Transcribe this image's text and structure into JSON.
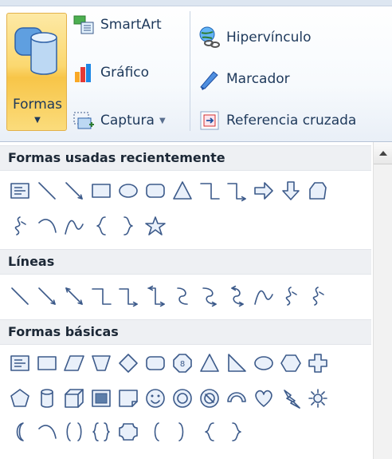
{
  "ribbon": {
    "formas": {
      "label": "Formas",
      "icon": "shapes-icon"
    },
    "illustrations": [
      {
        "label": "SmartArt",
        "icon": "smartart-icon"
      },
      {
        "label": "Gráfico",
        "icon": "chart-icon"
      },
      {
        "label": "Captura",
        "icon": "screenshot-icon",
        "has_dropdown": true
      }
    ],
    "links": [
      {
        "label": "Hipervínculo",
        "icon": "hyperlink-icon"
      },
      {
        "label": "Marcador",
        "icon": "bookmark-icon"
      },
      {
        "label": "Referencia cruzada",
        "icon": "cross-reference-icon"
      }
    ]
  },
  "gallery": {
    "sections": [
      {
        "title": "Formas usadas recientemente",
        "rows": [
          [
            "text-box",
            "line",
            "arrow-line",
            "rectangle",
            "oval",
            "rounded-rectangle",
            "triangle",
            "elbow-connector",
            "elbow-arrow-connector",
            "right-arrow",
            "down-arrow",
            "flowchart-shape"
          ],
          [
            "freeform",
            "arc",
            "curve",
            "left-brace",
            "right-brace",
            "star"
          ]
        ]
      },
      {
        "title": "Líneas",
        "rows": [
          [
            "line",
            "arrow-line",
            "double-arrow-line",
            "elbow-connector",
            "elbow-arrow-connector",
            "elbow-double-arrow-connector",
            "curved-connector",
            "curved-arrow-connector",
            "curved-double-arrow-connector",
            "curve",
            "freeform",
            "scribble"
          ]
        ]
      },
      {
        "title": "Formas básicas",
        "rows": [
          [
            "text-box",
            "rectangle",
            "parallelogram",
            "trapezoid",
            "diamond",
            "rounded-rectangle",
            "octagon",
            "triangle",
            "right-triangle",
            "oval",
            "hexagon",
            "cross"
          ],
          [
            "pentagon",
            "can",
            "cube",
            "bevel",
            "folded-corner",
            "smiley-face",
            "donut",
            "no-symbol",
            "block-arc",
            "heart",
            "lightning-bolt",
            "sun"
          ],
          [
            "moon",
            "arc",
            "double-bracket",
            "double-brace",
            "plaque",
            "left-bracket",
            "right-bracket",
            "left-brace",
            "right-brace"
          ]
        ]
      }
    ]
  },
  "colors": {
    "shape_stroke": "#3c5a8a",
    "shape_fill": "#e9f0fa",
    "ribbon_active": "#fbd870"
  }
}
